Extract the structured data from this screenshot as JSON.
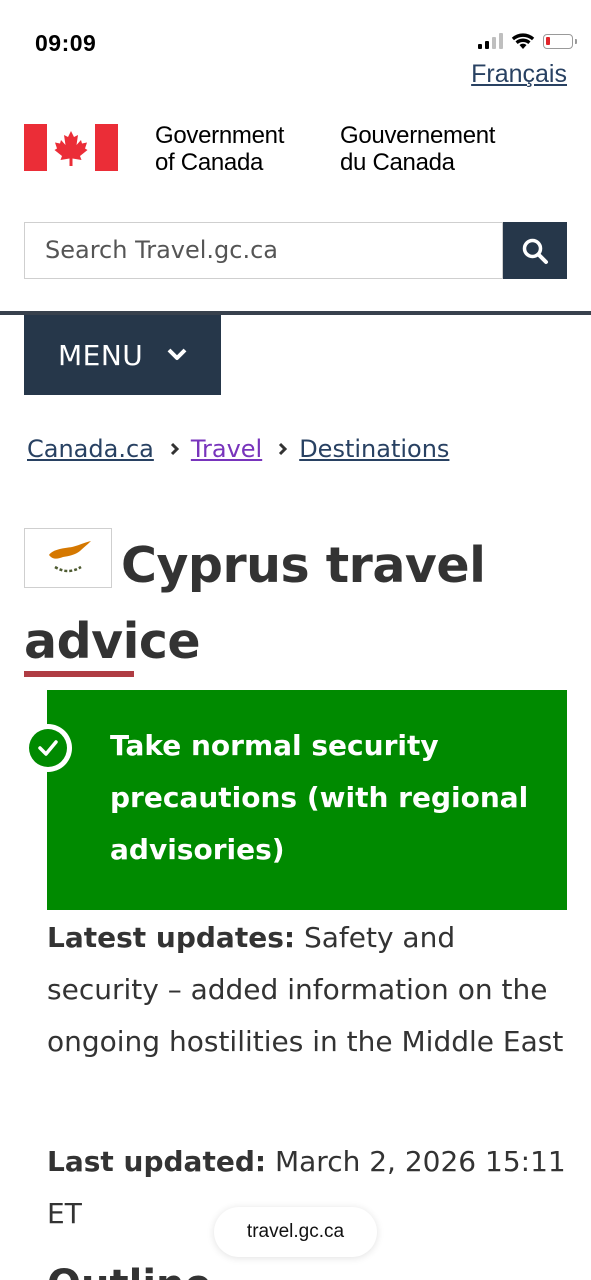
{
  "status_bar": {
    "time": "09:09",
    "signal_icon": "cellular-signal-icon",
    "wifi_icon": "wifi-icon",
    "battery_icon": "battery-low-icon"
  },
  "header": {
    "language_link": "Français",
    "gov_en": "Government\nof Canada",
    "gov_fr": "Gouvernement\ndu Canada",
    "flag_icon": "canada-flag-icon"
  },
  "search": {
    "placeholder": "Search Travel.gc.ca",
    "button_icon": "search-icon"
  },
  "menu": {
    "label": "MENU",
    "icon": "chevron-down-icon"
  },
  "breadcrumb": [
    {
      "label": "Canada.ca",
      "visited": false
    },
    {
      "label": "Travel",
      "visited": true
    },
    {
      "label": "Destinations",
      "visited": false
    }
  ],
  "page": {
    "title": "Cyprus travel advice",
    "flag_icon": "cyprus-flag-icon"
  },
  "advisory": {
    "level_text": "Take normal security precautions (with regional advisories)",
    "icon": "check-circle-icon"
  },
  "updates": {
    "latest_label": "Latest updates:",
    "latest_text": " Safety and security – added information on the ongoing hostilities in the Middle East",
    "last_label": "Last updated:",
    "last_text": " March 2, 2026 15:11 ET"
  },
  "partial_heading": "Outline",
  "browser": {
    "url": "travel.gc.ca"
  },
  "colors": {
    "navy": "#26374a",
    "link": "#284162",
    "visited": "#7834bc",
    "advisory_green": "#008a00",
    "accent_red": "#af3c43",
    "canada_red": "#eb2d37"
  }
}
